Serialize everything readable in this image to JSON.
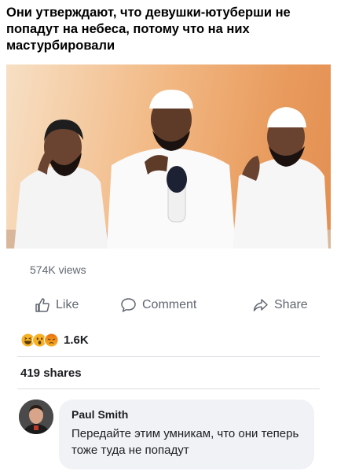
{
  "caption": "Они утверждают, что девушки-ютуберши не попадут на небеса, потому что на них мастурбировали",
  "post": {
    "views": "574K views",
    "actions": {
      "like": "Like",
      "comment": "Comment",
      "share": "Share"
    },
    "reactions": {
      "icons": [
        "haha-emoji-icon",
        "wow-emoji-icon",
        "angry-emoji-icon"
      ],
      "count": "1.6K"
    },
    "shares": "419 shares"
  },
  "comment": {
    "author": "Paul Smith",
    "text": "Передайте этим умникам, что они теперь тоже туда не попадут"
  },
  "colors": {
    "muted_text": "#606770",
    "bubble_bg": "#f0f2f5",
    "divider": "#dadde1",
    "photo_bg": "#e89a5c"
  }
}
